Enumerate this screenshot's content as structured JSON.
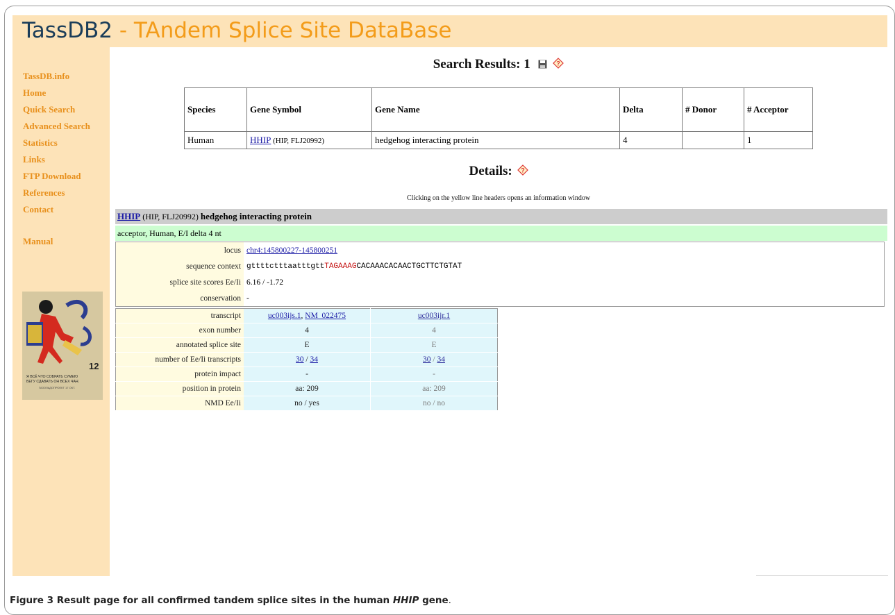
{
  "header": {
    "title_part1": "TassDB2",
    "title_part2": " - TAndem Splice Site DataBase"
  },
  "sidebar": {
    "items": [
      "TassDB.info",
      "Home",
      "Quick Search",
      "Advanced Search",
      "Statistics",
      "Links",
      "FTP Download",
      "References",
      "Contact"
    ],
    "manual": "Manual",
    "poster": {
      "caption1": "Я ВСЁ ЧТО СОБРАТЬ СУМЕЮ",
      "caption2": "БЕГУ СДАВАТЬ ОН ВСЕХ ЧАН.",
      "caption3": "ГАЗОЛЬДОПРОЕКТ 17 ОКТ.",
      "number": "12"
    }
  },
  "search_results": {
    "title": "Search Results: 1",
    "headers": [
      "Species",
      "Gene Symbol",
      "Gene Name",
      "Delta",
      "# Donor",
      "# Acceptor"
    ],
    "row": {
      "species": "Human",
      "symbol": "HHIP",
      "alias": " (HIP, FLJ20992)",
      "name": "hedgehog interacting protein",
      "delta": "4",
      "donor": "",
      "acceptor": "1"
    }
  },
  "details": {
    "title": "Details:",
    "note": "Clicking on the yellow line headers opens an information window",
    "gene_symbol": "HHIP",
    "gene_alias": " (HIP, FLJ20992) ",
    "gene_name": "hedgehog interacting protein",
    "subtitle": "acceptor, Human, E/I delta 4 nt",
    "locus_label": "locus",
    "locus_value": "chr4:145800227-145800251",
    "seq_label": "sequence context",
    "seq_lower": "gttttctttaatttgtt",
    "seq_red": "TAGAAAG",
    "seq_upper": "CACAAACACAACTGCTTCTGTAT",
    "scores_label": "splice site scores Ee/Ii",
    "scores_value": "6.16 / -1.72",
    "cons_label": "conservation",
    "cons_value": "-"
  },
  "transcripts": {
    "labels": [
      "transcript",
      "exon number",
      "annotated splice site",
      "number of Ee/Ii transcripts",
      "protein impact",
      "position in protein",
      "NMD Ee/Ii"
    ],
    "c1": {
      "tx_a": "uc003ijs.1",
      "sep": ", ",
      "tx_b": "NM_022475",
      "exon": "4",
      "annot": "E",
      "n_ee": "30",
      "slash": " / ",
      "n_ii": "34",
      "impact": "-",
      "pos": "aa: 209",
      "nmd": "no / yes"
    },
    "c2": {
      "tx_a": "uc003ijr.1",
      "exon": "4",
      "annot": "E",
      "n_ee": "30",
      "slash": " / ",
      "n_ii": "34",
      "impact": "-",
      "pos": "aa: 209",
      "nmd": "no / no"
    }
  },
  "caption": {
    "label": "Figure 3",
    "text1": " Result page for all confirmed tandem splice sites in the human ",
    "gene": "HHIP",
    "text2": " gene",
    "end": "."
  }
}
